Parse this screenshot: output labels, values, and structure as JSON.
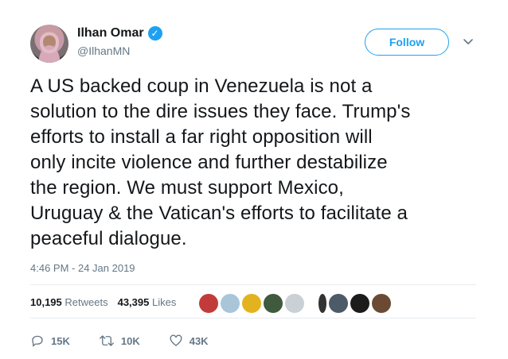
{
  "author": {
    "name": "Ilhan Omar",
    "handle": "@IlhanMN",
    "verified_icon": "verified-badge-icon"
  },
  "follow_label": "Follow",
  "tweet": {
    "text": "A US backed coup in Venezuela is not a\nsolution to the dire issues they face. Trump's\nefforts to install a far right opposition will\nonly incite violence and further destabilize\nthe region. We must support Mexico,\nUruguay & the Vatican's efforts to facilitate a\npeaceful dialogue.",
    "timestamp": "4:46 PM - 24 Jan 2019"
  },
  "stats": {
    "retweets_count": "10,195",
    "retweets_label": "Retweets",
    "likes_count": "43,395",
    "likes_label": "Likes"
  },
  "actions": {
    "replies": "15K",
    "retweets": "10K",
    "likes": "43K"
  },
  "colors": {
    "accent": "#1da1f2",
    "muted": "#657786",
    "text": "#14171a"
  }
}
